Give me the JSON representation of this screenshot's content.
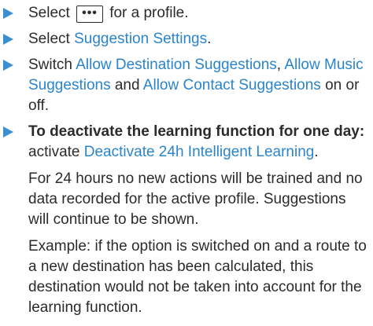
{
  "colors": {
    "accent": "#2a84cc",
    "bullet": "#3a8fd1",
    "text": "#2b2b2b"
  },
  "icons": {
    "step_marker": "triangle-right-icon"
  },
  "step1": {
    "before": "Select",
    "button_label": "•••",
    "after": "for a profile."
  },
  "step2": {
    "before": "Select ",
    "link": "Suggestion Settings",
    "after": "."
  },
  "step3": {
    "before": "Switch ",
    "option1": "Allow Destination Suggestions",
    "sep1": ", ",
    "option2": "Allow Music Suggestions",
    "sep2": " and ",
    "option3": "Allow Contact Sug­gestions",
    "after": " on or off."
  },
  "step4": {
    "heading": "To deactivate the learning function for one day:",
    "before": " activate ",
    "option": "Deactivate 24h Intelligent Learning",
    "after": ".",
    "note": "For 24 hours no new actions will be trained and no data recorded for the active profile. Suggestions will continue to be shown.",
    "example": "Example: if the option is switched on and a route to a new destination has been calcula­ted, this destination would not be taken into account for the learning function."
  }
}
